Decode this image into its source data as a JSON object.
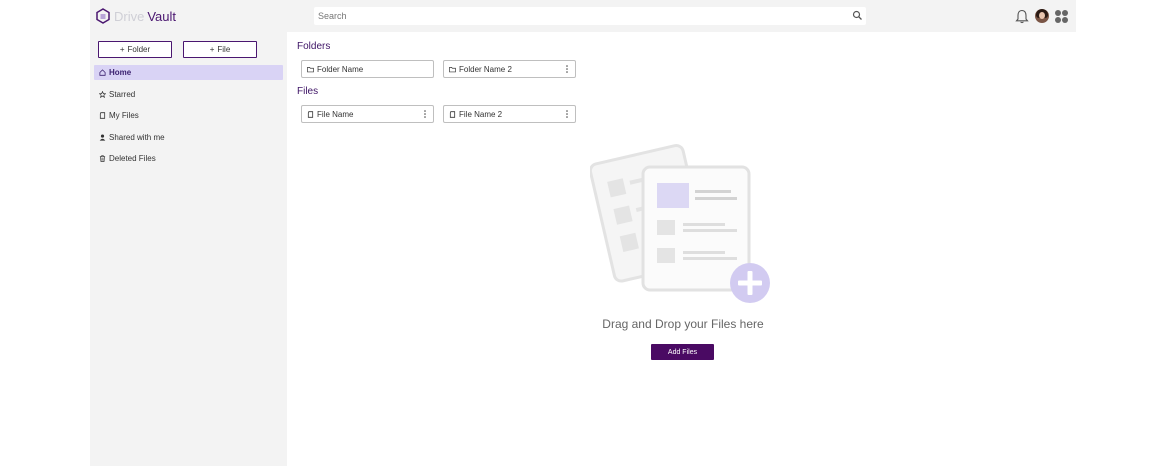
{
  "app": {
    "brand_light": "Drive",
    "brand_dark": "Vault",
    "accent": "#4a0a63",
    "highlight": "#d9d3f5"
  },
  "header": {
    "search_placeholder": "Search"
  },
  "sidebar": {
    "new_folder_label": "Folder",
    "new_file_label": "File",
    "items": [
      {
        "label": "Home",
        "icon": "home-icon",
        "active": true
      },
      {
        "label": "Starred",
        "icon": "star-icon"
      },
      {
        "label": "My Files",
        "icon": "file-icon"
      },
      {
        "label": "Shared with me",
        "icon": "person-icon"
      },
      {
        "label": "Deleted Files",
        "icon": "trash-icon"
      }
    ]
  },
  "main": {
    "folders_title": "Folders",
    "files_title": "Files",
    "folders": [
      {
        "name": "Folder Name"
      },
      {
        "name": "Folder Name 2"
      }
    ],
    "files": [
      {
        "name": "File Name"
      },
      {
        "name": "File Name 2"
      }
    ],
    "dropzone_text": "Drag and Drop your Files here",
    "add_files_label": "Add Files"
  }
}
